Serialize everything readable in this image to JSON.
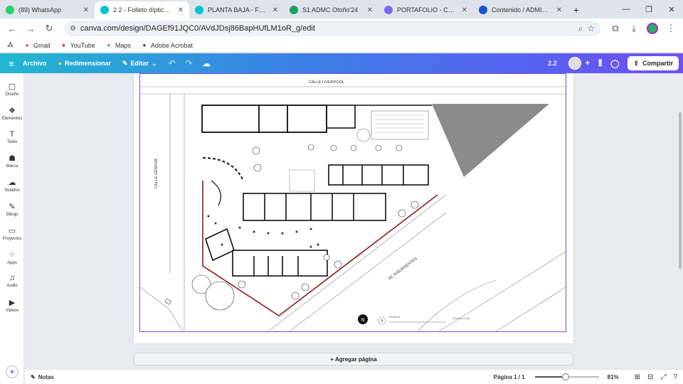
{
  "tabs": [
    {
      "title": "(89) WhatsApp",
      "fav_color": "#25d366",
      "active": false
    },
    {
      "title": "2 2 - Folleto díptico (43,1 x",
      "fav_color": "#00c4cc",
      "active": true
    },
    {
      "title": "PLANTA BAJA - Folleto díp",
      "fav_color": "#00c4cc",
      "active": false
    },
    {
      "title": "S1 ADMC Otoño'24",
      "fav_color": "#1aa260",
      "active": false
    },
    {
      "title": "PORTAFOLIO - Carta forma",
      "fav_color": "#7b68ee",
      "active": false
    },
    {
      "title": "Contenido / ADMINISTRAC",
      "fav_color": "#1f4fd1",
      "active": false
    }
  ],
  "url": "canva.com/design/DAGEf91JQC0/AVdJDsj86BapHUfLM1oR_g/edit",
  "bookmarks": [
    {
      "label": "Gmail",
      "color": "#ea4335"
    },
    {
      "label": "YouTube",
      "color": "#ff0000"
    },
    {
      "label": "Maps",
      "color": "#34a853"
    },
    {
      "label": "Adobe Acrobat",
      "color": "#333333"
    }
  ],
  "header": {
    "archivo": "Archivo",
    "redimensionar": "Redimensionar",
    "editar": "Editar",
    "doc_title": "2.2",
    "share": "Compartir"
  },
  "rail": [
    {
      "label": "Diseño",
      "icon": "▢"
    },
    {
      "label": "Elementos",
      "icon": "❖"
    },
    {
      "label": "Texto",
      "icon": "T"
    },
    {
      "label": "Marca",
      "icon": "☗"
    },
    {
      "label": "Subidos",
      "icon": "☁"
    },
    {
      "label": "Dibujo",
      "icon": "✎"
    },
    {
      "label": "Proyectos",
      "icon": "▭"
    },
    {
      "label": "Apps",
      "icon": "⁘"
    },
    {
      "label": "Audio",
      "icon": "♫"
    },
    {
      "label": "Videos",
      "icon": "▶"
    }
  ],
  "plan": {
    "street_top": "CALLE LIVERPOOL",
    "street_left": "CALLE GENOVA",
    "street_diag": "AV. INSURGENTES",
    "legend_letter": "B",
    "legend_title": "PLANTA",
    "legend_scale": "ESCALA 1:200",
    "north": "N"
  },
  "add_page": "+ Agregar página",
  "footer": {
    "notes": "Notas",
    "page": "Página 1 / 1",
    "zoom_label": "81%",
    "zoom_percent": 81
  }
}
